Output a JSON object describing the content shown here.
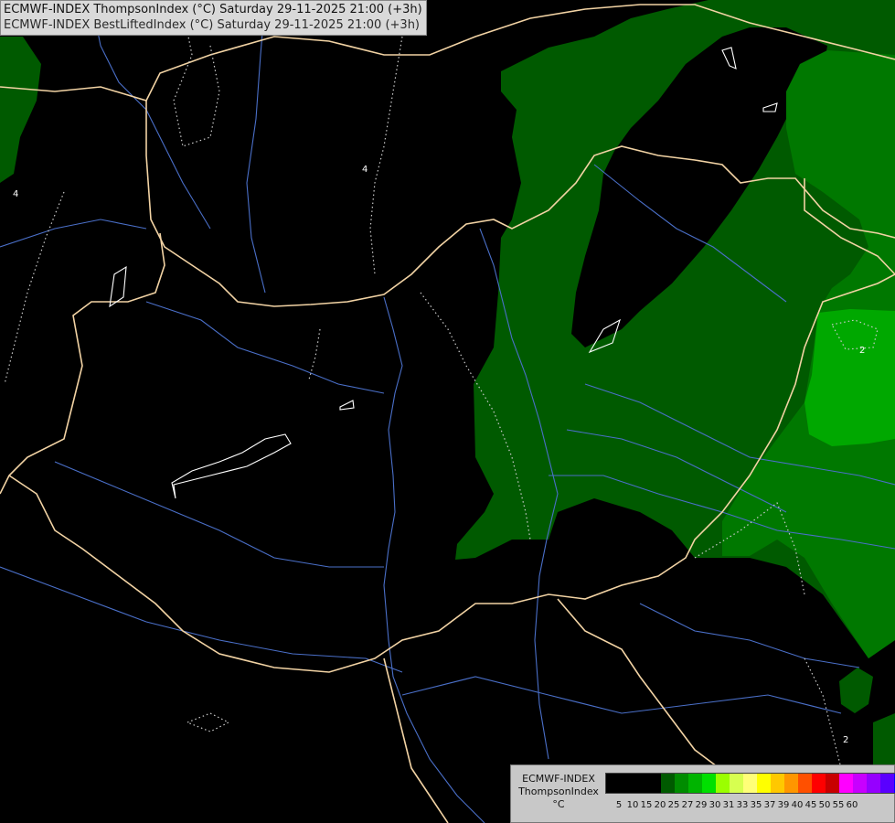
{
  "header": {
    "line1": "ECMWF-INDEX ThompsonIndex (°C) Saturday 29-11-2025 21:00 (+3h)",
    "line2": "ECMWF-INDEX BestLiftedIndex (°C) Saturday 29-11-2025 21:00 (+3h)"
  },
  "map": {
    "contour_labels": [
      "4",
      "4",
      "2",
      "2"
    ],
    "fill_colors": {
      "dark_green": "#005a00",
      "mid_green": "#007800",
      "bright_green": "#00a800"
    },
    "border_color": "#f2d3a4",
    "river_color": "#4a6fc8"
  },
  "legend": {
    "label_line1": "ECMWF-INDEX",
    "label_line2": "ThompsonIndex",
    "label_line3": "°C",
    "colors": [
      "#000000",
      "#000000",
      "#000000",
      "#000000",
      "#005a00",
      "#008c00",
      "#00b400",
      "#00e000",
      "#9bff00",
      "#d7ff50",
      "#ffff78",
      "#ffff00",
      "#ffc800",
      "#ff9600",
      "#ff5000",
      "#ff0000",
      "#c80000",
      "#ff00ff",
      "#c800ff",
      "#9600ff",
      "#5a00ff",
      "#0000ff"
    ],
    "ticks": [
      "5",
      "10",
      "15",
      "20",
      "25",
      "27",
      "29",
      "30",
      "31",
      "33",
      "35",
      "37",
      "39",
      "40",
      "45",
      "50",
      "55",
      "60"
    ]
  }
}
